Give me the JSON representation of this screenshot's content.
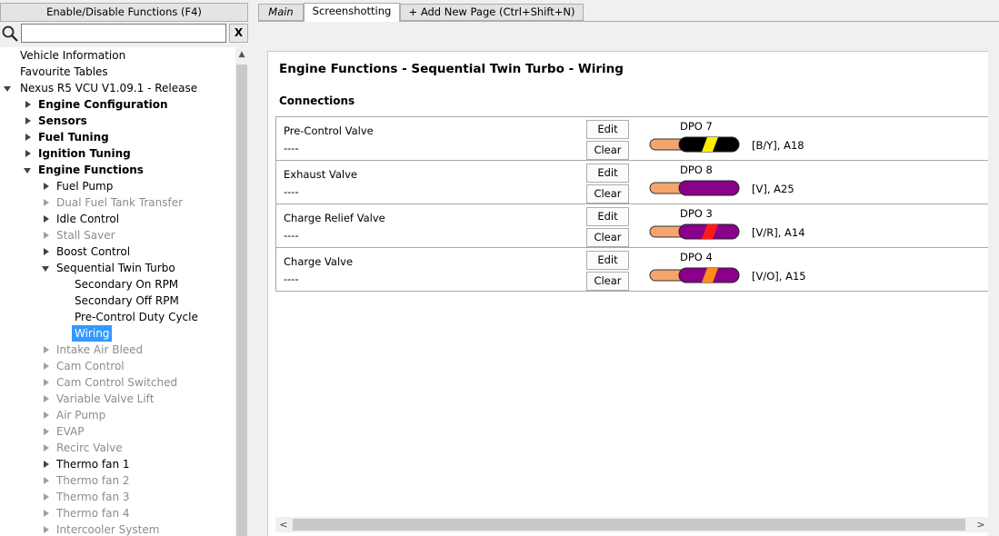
{
  "left": {
    "toggle_label": "Enable/Disable Functions (F4)",
    "search_placeholder": "",
    "search_clear": "X",
    "tree": [
      {
        "label": "Vehicle Information",
        "style": "normal",
        "arrow": "none",
        "depth": 0
      },
      {
        "label": "Favourite Tables",
        "style": "normal",
        "arrow": "none",
        "depth": 0
      },
      {
        "label": "Nexus R5 VCU V1.09.1 - Release",
        "style": "normal",
        "arrow": "down",
        "depth": 0
      },
      {
        "label": "Engine Configuration",
        "style": "bold",
        "arrow": "right",
        "depth": 1
      },
      {
        "label": "Sensors",
        "style": "bold",
        "arrow": "right",
        "depth": 1
      },
      {
        "label": "Fuel Tuning",
        "style": "bold",
        "arrow": "right",
        "depth": 1
      },
      {
        "label": "Ignition Tuning",
        "style": "bold",
        "arrow": "right",
        "depth": 1
      },
      {
        "label": "Engine Functions",
        "style": "bold",
        "arrow": "down",
        "depth": 1
      },
      {
        "label": "Fuel Pump",
        "style": "normal",
        "arrow": "right",
        "depth": 2
      },
      {
        "label": "Dual Fuel Tank Transfer",
        "style": "disabled",
        "arrow": "right-grey",
        "depth": 2
      },
      {
        "label": "Idle Control",
        "style": "normal",
        "arrow": "right",
        "depth": 2
      },
      {
        "label": "Stall Saver",
        "style": "disabled",
        "arrow": "right-grey",
        "depth": 2
      },
      {
        "label": "Boost Control",
        "style": "normal",
        "arrow": "right",
        "depth": 2
      },
      {
        "label": "Sequential Twin Turbo",
        "style": "normal",
        "arrow": "down",
        "depth": 2
      },
      {
        "label": "Secondary On RPM",
        "style": "normal",
        "arrow": "none",
        "depth": 3
      },
      {
        "label": "Secondary Off RPM",
        "style": "normal",
        "arrow": "none",
        "depth": 3
      },
      {
        "label": "Pre-Control Duty Cycle",
        "style": "normal",
        "arrow": "none",
        "depth": 3
      },
      {
        "label": "Wiring",
        "style": "selected",
        "arrow": "none",
        "depth": 3
      },
      {
        "label": "Intake Air Bleed",
        "style": "disabled",
        "arrow": "right-grey",
        "depth": 2
      },
      {
        "label": "Cam Control",
        "style": "disabled",
        "arrow": "right-grey",
        "depth": 2
      },
      {
        "label": "Cam Control Switched",
        "style": "disabled",
        "arrow": "right-grey",
        "depth": 2
      },
      {
        "label": "Variable Valve Lift",
        "style": "disabled",
        "arrow": "right-grey",
        "depth": 2
      },
      {
        "label": "Air Pump",
        "style": "disabled",
        "arrow": "right-grey",
        "depth": 2
      },
      {
        "label": "EVAP",
        "style": "disabled",
        "arrow": "right-grey",
        "depth": 2
      },
      {
        "label": "Recirc Valve",
        "style": "disabled",
        "arrow": "right-grey",
        "depth": 2
      },
      {
        "label": "Thermo fan 1",
        "style": "normal",
        "arrow": "right",
        "depth": 2
      },
      {
        "label": "Thermo fan 2",
        "style": "disabled",
        "arrow": "right-grey",
        "depth": 2
      },
      {
        "label": "Thermo fan 3",
        "style": "disabled",
        "arrow": "right-grey",
        "depth": 2
      },
      {
        "label": "Thermo fan 4",
        "style": "disabled",
        "arrow": "right-grey",
        "depth": 2
      },
      {
        "label": "Intercooler System",
        "style": "disabled",
        "arrow": "right-grey",
        "depth": 2
      }
    ]
  },
  "tabs": {
    "main": "Main",
    "screenshotting": "Screenshotting",
    "add": "+ Add New Page (Ctrl+Shift+N)"
  },
  "page": {
    "title": "Engine Functions - Sequential Twin Turbo - Wiring",
    "section": "Connections",
    "edit_label": "Edit",
    "clear_label": "Clear",
    "connections": [
      {
        "name": "Pre-Control Valve",
        "value": "----",
        "dpo": "DPO 7",
        "code": "[B/Y], A18",
        "base_color": "#000000",
        "stripe_color": "#ffee00"
      },
      {
        "name": "Exhaust Valve",
        "value": "----",
        "dpo": "DPO 8",
        "code": "[V], A25",
        "base_color": "#8a008a",
        "stripe_color": ""
      },
      {
        "name": "Charge Relief Valve",
        "value": "----",
        "dpo": "DPO 3",
        "code": "[V/R], A14",
        "base_color": "#8a008a",
        "stripe_color": "#ff1a1a"
      },
      {
        "name": "Charge Valve",
        "value": "----",
        "dpo": "DPO 4",
        "code": "[V/O], A15",
        "base_color": "#8a008a",
        "stripe_color": "#ff8c1a"
      }
    ]
  },
  "colors": {
    "selection": "#3399ff",
    "copper": "#f5a46e"
  }
}
